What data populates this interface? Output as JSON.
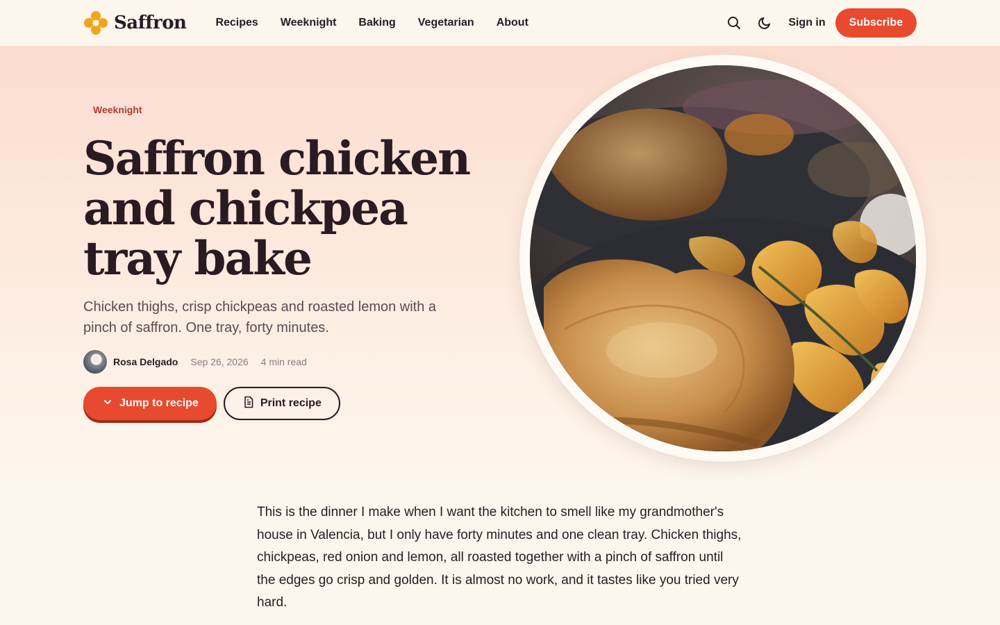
{
  "brand": {
    "name": "Saffron",
    "logo_icon": "flower-icon",
    "accent": "#f2a51a"
  },
  "nav": {
    "links": [
      "Recipes",
      "Weeknight",
      "Baking",
      "Vegetarian",
      "About"
    ],
    "search_icon": "search-icon",
    "theme_icon": "moon-icon",
    "signin_label": "Sign in",
    "subscribe_label": "Subscribe"
  },
  "hero": {
    "tag": "Weeknight",
    "title": "Saffron chicken and chickpea tray bake",
    "subtitle": "Chicken thighs, crisp chickpeas and roasted lemon with a pinch of saffron. One tray, forty minutes.",
    "author": "Rosa Delgado",
    "date": "Sep 26, 2026",
    "read_time": "4 min read",
    "jump_label": "Jump to recipe",
    "print_label": "Print recipe",
    "image_subject": "roasted chicken thigh with potato wedges"
  },
  "article": {
    "intro": "This is the dinner I make when I want the kitchen to smell like my grandmother's house in Valencia, but I only have forty minutes and one clean tray. Chicken thighs, chickpeas, red onion and lemon, all roasted together with a pinch of saffron until the edges go crisp and golden. It is almost no work, and it tastes like you tried very hard."
  },
  "colors": {
    "primary": "#e84a2f",
    "text": "#2a1a22",
    "background": "#fdf6ec"
  }
}
